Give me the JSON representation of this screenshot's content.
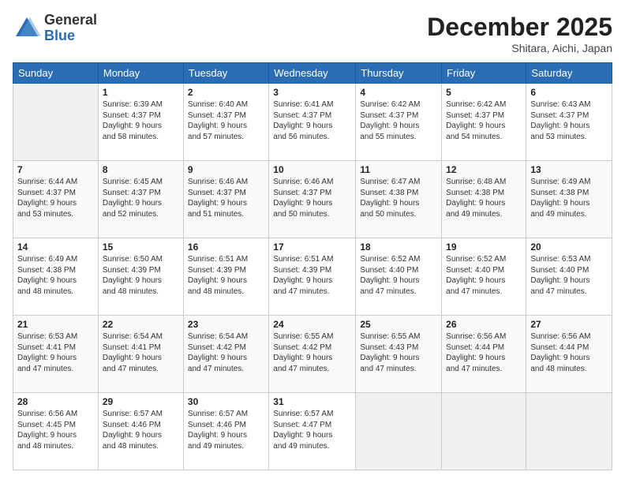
{
  "header": {
    "logo_general": "General",
    "logo_blue": "Blue",
    "month_title": "December 2025",
    "location": "Shitara, Aichi, Japan"
  },
  "days_of_week": [
    "Sunday",
    "Monday",
    "Tuesday",
    "Wednesday",
    "Thursday",
    "Friday",
    "Saturday"
  ],
  "weeks": [
    [
      {
        "day": "",
        "info": ""
      },
      {
        "day": "1",
        "info": "Sunrise: 6:39 AM\nSunset: 4:37 PM\nDaylight: 9 hours\nand 58 minutes."
      },
      {
        "day": "2",
        "info": "Sunrise: 6:40 AM\nSunset: 4:37 PM\nDaylight: 9 hours\nand 57 minutes."
      },
      {
        "day": "3",
        "info": "Sunrise: 6:41 AM\nSunset: 4:37 PM\nDaylight: 9 hours\nand 56 minutes."
      },
      {
        "day": "4",
        "info": "Sunrise: 6:42 AM\nSunset: 4:37 PM\nDaylight: 9 hours\nand 55 minutes."
      },
      {
        "day": "5",
        "info": "Sunrise: 6:42 AM\nSunset: 4:37 PM\nDaylight: 9 hours\nand 54 minutes."
      },
      {
        "day": "6",
        "info": "Sunrise: 6:43 AM\nSunset: 4:37 PM\nDaylight: 9 hours\nand 53 minutes."
      }
    ],
    [
      {
        "day": "7",
        "info": "Sunrise: 6:44 AM\nSunset: 4:37 PM\nDaylight: 9 hours\nand 53 minutes."
      },
      {
        "day": "8",
        "info": "Sunrise: 6:45 AM\nSunset: 4:37 PM\nDaylight: 9 hours\nand 52 minutes."
      },
      {
        "day": "9",
        "info": "Sunrise: 6:46 AM\nSunset: 4:37 PM\nDaylight: 9 hours\nand 51 minutes."
      },
      {
        "day": "10",
        "info": "Sunrise: 6:46 AM\nSunset: 4:37 PM\nDaylight: 9 hours\nand 50 minutes."
      },
      {
        "day": "11",
        "info": "Sunrise: 6:47 AM\nSunset: 4:38 PM\nDaylight: 9 hours\nand 50 minutes."
      },
      {
        "day": "12",
        "info": "Sunrise: 6:48 AM\nSunset: 4:38 PM\nDaylight: 9 hours\nand 49 minutes."
      },
      {
        "day": "13",
        "info": "Sunrise: 6:49 AM\nSunset: 4:38 PM\nDaylight: 9 hours\nand 49 minutes."
      }
    ],
    [
      {
        "day": "14",
        "info": "Sunrise: 6:49 AM\nSunset: 4:38 PM\nDaylight: 9 hours\nand 48 minutes."
      },
      {
        "day": "15",
        "info": "Sunrise: 6:50 AM\nSunset: 4:39 PM\nDaylight: 9 hours\nand 48 minutes."
      },
      {
        "day": "16",
        "info": "Sunrise: 6:51 AM\nSunset: 4:39 PM\nDaylight: 9 hours\nand 48 minutes."
      },
      {
        "day": "17",
        "info": "Sunrise: 6:51 AM\nSunset: 4:39 PM\nDaylight: 9 hours\nand 47 minutes."
      },
      {
        "day": "18",
        "info": "Sunrise: 6:52 AM\nSunset: 4:40 PM\nDaylight: 9 hours\nand 47 minutes."
      },
      {
        "day": "19",
        "info": "Sunrise: 6:52 AM\nSunset: 4:40 PM\nDaylight: 9 hours\nand 47 minutes."
      },
      {
        "day": "20",
        "info": "Sunrise: 6:53 AM\nSunset: 4:40 PM\nDaylight: 9 hours\nand 47 minutes."
      }
    ],
    [
      {
        "day": "21",
        "info": "Sunrise: 6:53 AM\nSunset: 4:41 PM\nDaylight: 9 hours\nand 47 minutes."
      },
      {
        "day": "22",
        "info": "Sunrise: 6:54 AM\nSunset: 4:41 PM\nDaylight: 9 hours\nand 47 minutes."
      },
      {
        "day": "23",
        "info": "Sunrise: 6:54 AM\nSunset: 4:42 PM\nDaylight: 9 hours\nand 47 minutes."
      },
      {
        "day": "24",
        "info": "Sunrise: 6:55 AM\nSunset: 4:42 PM\nDaylight: 9 hours\nand 47 minutes."
      },
      {
        "day": "25",
        "info": "Sunrise: 6:55 AM\nSunset: 4:43 PM\nDaylight: 9 hours\nand 47 minutes."
      },
      {
        "day": "26",
        "info": "Sunrise: 6:56 AM\nSunset: 4:44 PM\nDaylight: 9 hours\nand 47 minutes."
      },
      {
        "day": "27",
        "info": "Sunrise: 6:56 AM\nSunset: 4:44 PM\nDaylight: 9 hours\nand 48 minutes."
      }
    ],
    [
      {
        "day": "28",
        "info": "Sunrise: 6:56 AM\nSunset: 4:45 PM\nDaylight: 9 hours\nand 48 minutes."
      },
      {
        "day": "29",
        "info": "Sunrise: 6:57 AM\nSunset: 4:46 PM\nDaylight: 9 hours\nand 48 minutes."
      },
      {
        "day": "30",
        "info": "Sunrise: 6:57 AM\nSunset: 4:46 PM\nDaylight: 9 hours\nand 49 minutes."
      },
      {
        "day": "31",
        "info": "Sunrise: 6:57 AM\nSunset: 4:47 PM\nDaylight: 9 hours\nand 49 minutes."
      },
      {
        "day": "",
        "info": ""
      },
      {
        "day": "",
        "info": ""
      },
      {
        "day": "",
        "info": ""
      }
    ]
  ]
}
